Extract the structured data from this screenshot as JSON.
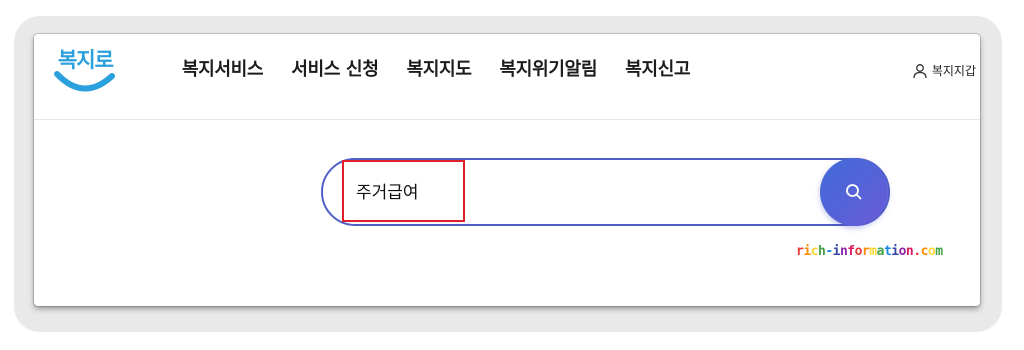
{
  "logo": {
    "text": "복지로",
    "brand_color": "#2aa0dc"
  },
  "nav": {
    "items": [
      {
        "label": "복지서비스"
      },
      {
        "label": "서비스 신청"
      },
      {
        "label": "복지지도"
      },
      {
        "label": "복지위기알림"
      },
      {
        "label": "복지신고"
      }
    ]
  },
  "user": {
    "label": "복지지갑",
    "icon": "user-icon"
  },
  "search": {
    "value": "주거급여",
    "button_icon": "search-icon",
    "border_color": "#4f5ec8",
    "highlight_color": "#e0202a"
  },
  "watermark": {
    "text": "rich-information.com"
  }
}
